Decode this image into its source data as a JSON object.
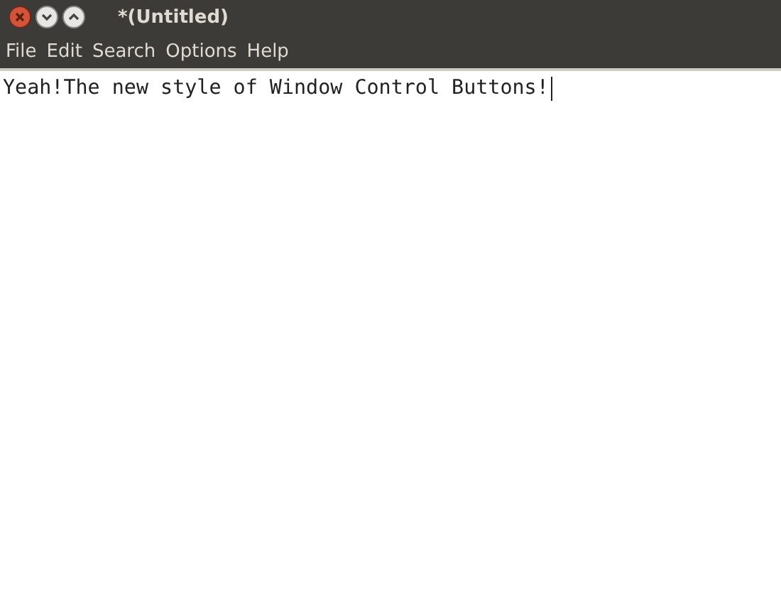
{
  "window": {
    "title": "*(Untitled)"
  },
  "menu": [
    "File",
    "Edit",
    "Search",
    "Options",
    "Help"
  ],
  "editor": {
    "text": "Yeah!The new style of Window Control Buttons!"
  }
}
